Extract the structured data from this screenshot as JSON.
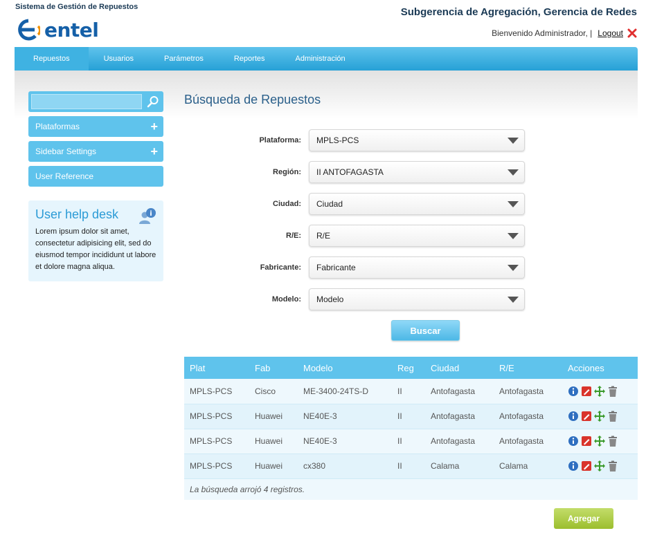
{
  "header": {
    "system_title": "Sistema de Gestión de Repuestos",
    "brand": "entel",
    "org_title": "Subgerencia de Agregación, Gerencia de Redes",
    "welcome": "Bienvenido Administrador, |",
    "logout": "Logout"
  },
  "nav": {
    "items": [
      {
        "label": "Repuestos"
      },
      {
        "label": "Usuarios"
      },
      {
        "label": "Parámetros"
      },
      {
        "label": "Reportes"
      },
      {
        "label": "Administración"
      }
    ],
    "active": "Repuestos"
  },
  "sidebar": {
    "search_value": "",
    "items": [
      {
        "label": "Plataformas"
      },
      {
        "label": "Sidebar Settings"
      },
      {
        "label": "User Reference"
      }
    ],
    "help": {
      "title": "User help desk",
      "text": "Lorem ipsum dolor sit amet, consectetur adipisicing elit, sed do eiusmod tempor incididunt ut labore et dolore magna aliqua."
    }
  },
  "main": {
    "title": "Búsqueda de Repuestos",
    "form": {
      "plataforma": {
        "label": "Plataforma:",
        "value": "MPLS-PCS"
      },
      "region": {
        "label": "Región:",
        "value": "II ANTOFAGASTA"
      },
      "ciudad": {
        "label": "Ciudad:",
        "value": "Ciudad"
      },
      "re": {
        "label": "R/E:",
        "value": "R/E"
      },
      "fabricante": {
        "label": "Fabricante:",
        "value": "Fabricante"
      },
      "modelo": {
        "label": "Modelo:",
        "value": "Modelo"
      }
    },
    "search_button": "Buscar",
    "table": {
      "headers": [
        "Plat",
        "Fab",
        "Modelo",
        "Reg",
        "Ciudad",
        "R/E",
        "Acciones"
      ],
      "rows": [
        [
          "MPLS-PCS",
          "Cisco",
          "ME-3400-24TS-D",
          "II",
          "Antofagasta",
          "Antofagasta"
        ],
        [
          "MPLS-PCS",
          "Huawei",
          "NE40E-3",
          "II",
          "Antofagasta",
          "Antofagasta"
        ],
        [
          "MPLS-PCS",
          "Huawei",
          "NE40E-3",
          "II",
          "Antofagasta",
          "Antofagasta"
        ],
        [
          "MPLS-PCS",
          "Huawei",
          "cx380",
          "II",
          "Calama",
          "Calama"
        ]
      ],
      "footer": "La búsqueda arrojó 4 registros."
    },
    "add_button": "Agregar"
  },
  "colors": {
    "accent": "#5fc3ec",
    "title": "#2a5f8a",
    "add_green": "#a8c83a",
    "brand_orange": "#f39200",
    "brand_blue": "#1560a8"
  },
  "icons": [
    "search-icon",
    "plus-icon",
    "help-user-icon",
    "close-icon",
    "info-icon",
    "edit-icon",
    "move-icon",
    "trash-icon"
  ]
}
